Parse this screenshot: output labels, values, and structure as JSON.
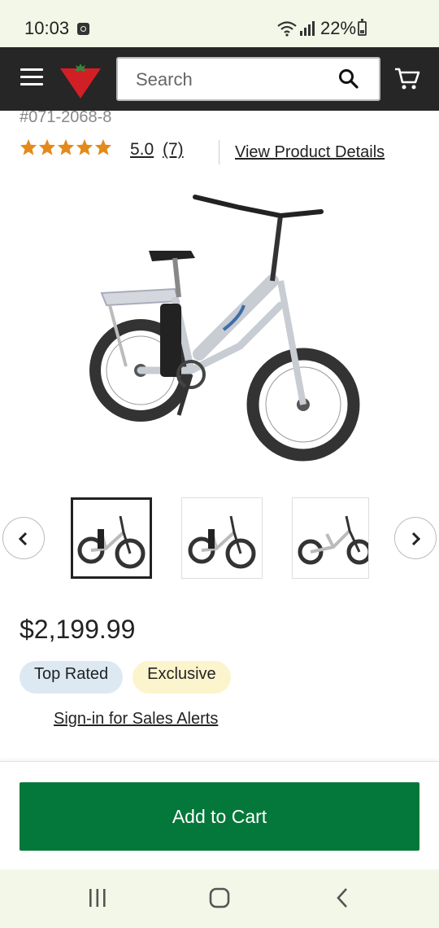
{
  "status_bar": {
    "time": "10:03",
    "battery": "22%"
  },
  "header": {
    "search_placeholder": "Search",
    "brand_color": "#d11f26"
  },
  "product": {
    "sku": "#071-2068-8",
    "rating_value": "5.0",
    "rating_count": "(7)",
    "star_count": 5,
    "star_color": "#e38a1b",
    "view_details_label": "View Product Details",
    "price": "$2,199.99",
    "badges": [
      "Top Rated",
      "Exclusive"
    ],
    "sales_alerts_label": "Sign-in for Sales Alerts"
  },
  "carousel": {
    "thumbnail_count": 3,
    "selected_index": 0
  },
  "cart": {
    "add_to_cart_label": "Add to Cart",
    "button_color": "#04773a"
  }
}
